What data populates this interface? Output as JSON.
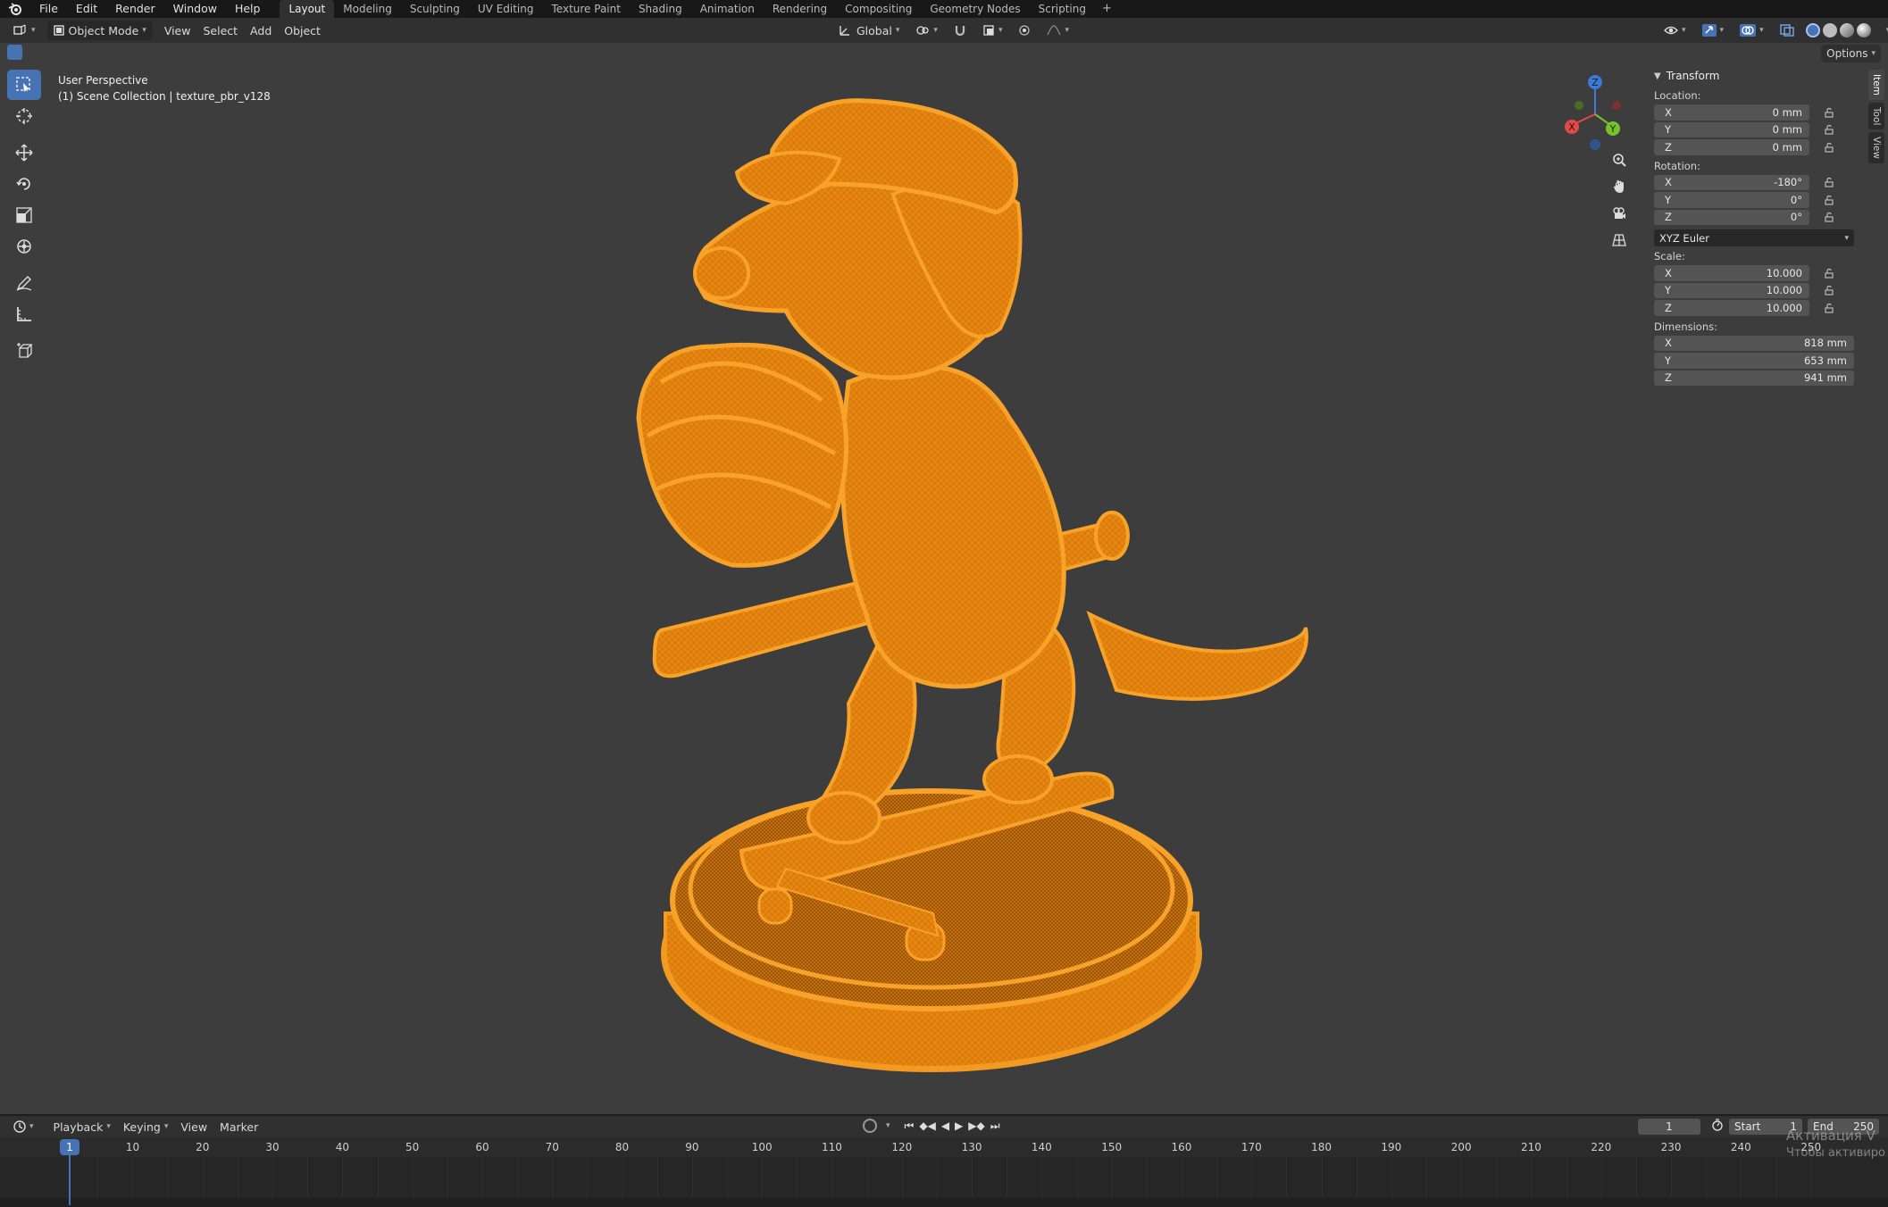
{
  "app": {
    "logo_icon": "blender-logo-icon"
  },
  "menu": [
    "File",
    "Edit",
    "Render",
    "Window",
    "Help"
  ],
  "workspaces": [
    "Layout",
    "Modeling",
    "Sculpting",
    "UV Editing",
    "Texture Paint",
    "Shading",
    "Animation",
    "Rendering",
    "Compositing",
    "Geometry Nodes",
    "Scripting"
  ],
  "active_workspace": "Layout",
  "header": {
    "mode": "Object Mode",
    "menus": [
      "View",
      "Select",
      "Add",
      "Object"
    ],
    "transform_orientation": "Global",
    "options_label": "Options"
  },
  "viewport": {
    "perspective_label": "User Perspective",
    "collection_label": "(1) Scene Collection | texture_pbr_v128",
    "object_color": "#e8870f",
    "background_color": "#3d3d3d"
  },
  "tools": [
    "select-box",
    "cursor",
    "move",
    "rotate",
    "scale",
    "transform",
    "annotate",
    "measure",
    "add-cube"
  ],
  "gizmo": {
    "x": "X",
    "y": "Y",
    "z": "Z"
  },
  "npanel": {
    "title": "Transform",
    "location_label": "Location:",
    "location": [
      {
        "axis": "X",
        "value": "0 mm"
      },
      {
        "axis": "Y",
        "value": "0 mm"
      },
      {
        "axis": "Z",
        "value": "0 mm"
      }
    ],
    "rotation_label": "Rotation:",
    "rotation": [
      {
        "axis": "X",
        "value": "-180°"
      },
      {
        "axis": "Y",
        "value": "0°"
      },
      {
        "axis": "Z",
        "value": "0°"
      }
    ],
    "rotation_mode": "XYZ Euler",
    "scale_label": "Scale:",
    "scale": [
      {
        "axis": "X",
        "value": "10.000"
      },
      {
        "axis": "Y",
        "value": "10.000"
      },
      {
        "axis": "Z",
        "value": "10.000"
      }
    ],
    "dimensions_label": "Dimensions:",
    "dimensions": [
      {
        "axis": "X",
        "value": "818 mm"
      },
      {
        "axis": "Y",
        "value": "653 mm"
      },
      {
        "axis": "Z",
        "value": "941 mm"
      }
    ],
    "tabs": [
      "Item",
      "Tool",
      "View"
    ]
  },
  "timeline": {
    "menus": [
      "Playback",
      "Keying",
      "View",
      "Marker"
    ],
    "current_frame": "1",
    "start_label": "Start",
    "start": "1",
    "end_label": "End",
    "end": "250",
    "ticks": [
      "10",
      "20",
      "30",
      "40",
      "50",
      "60",
      "70",
      "80",
      "90",
      "100",
      "110",
      "120",
      "130",
      "140",
      "150",
      "160",
      "170",
      "180",
      "190",
      "200",
      "210",
      "220",
      "230",
      "240",
      "250"
    ]
  },
  "watermark": {
    "line1": "Активация V",
    "line2": "Чтобы активиро"
  }
}
